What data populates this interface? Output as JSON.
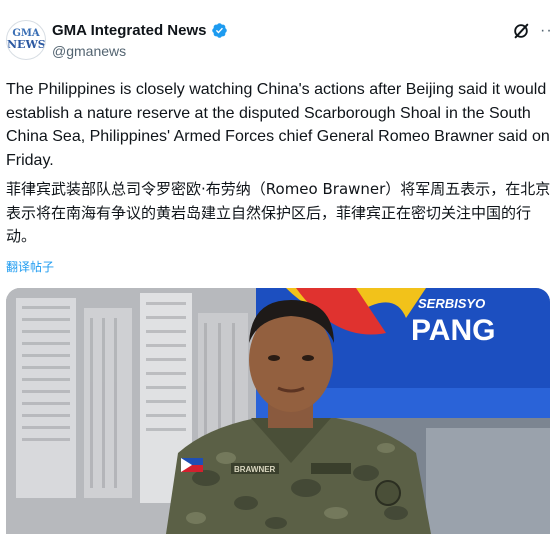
{
  "account": {
    "display_name": "GMA Integrated News",
    "handle": "@gmanews",
    "avatar_text_top": "GMA",
    "avatar_text_bottom": "NEWS"
  },
  "post": {
    "body_en": "The Philippines is closely watching China's actions after Beijing said it would establish a nature reserve at the disputed Scarborough Shoal in the South China Sea, Philippines' Armed Forces chief General Romeo Brawner said on Friday.",
    "body_zh": "菲律宾武装部队总司令罗密欧·布劳纳（Romeo Brawner）将军周五表示，在北京表示将在南海有争议的黄岩岛建立自然保护区后，菲律宾正在密切关注中国的行动。",
    "translate_label": "翻译帖子"
  },
  "media": {
    "banner_small": "SERBISYO",
    "banner_large": "PANG",
    "nametag": "BRAWNER"
  },
  "icons": {
    "verified": "verified-badge-icon",
    "grok": "grok-icon",
    "more": "more-options-icon"
  },
  "colors": {
    "accent": "#1d9bf0",
    "handle": "#536471",
    "banner_blue": "#1c4fc0"
  }
}
